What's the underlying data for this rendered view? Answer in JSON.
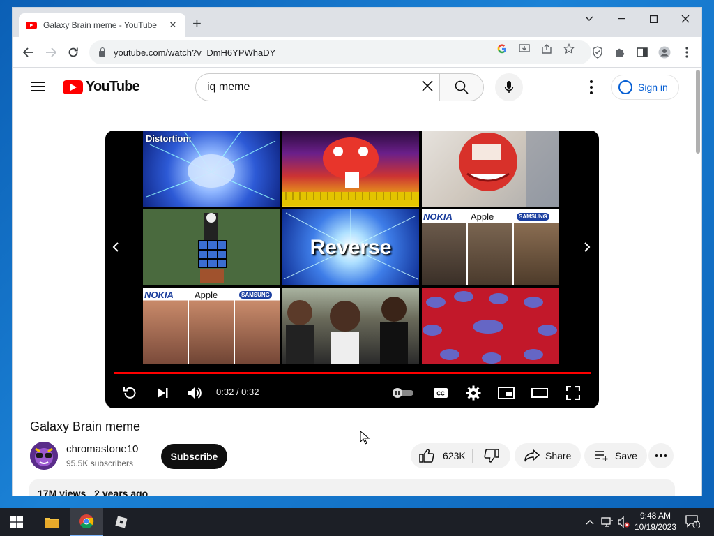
{
  "browser": {
    "tab_title": "Galaxy Brain meme - YouTube",
    "url": "youtube.com/watch?v=DmH6YPWhaDY",
    "icons": [
      "back-icon",
      "forward-icon",
      "reload-icon",
      "google-icon",
      "install-icon",
      "share-icon",
      "bookmark-star-icon",
      "shield-extension-icon",
      "puzzle-extensions-icon",
      "sidebar-icon",
      "profile-icon",
      "menu-icon"
    ]
  },
  "youtube": {
    "logo_text": "YouTube",
    "search_value": "iq meme",
    "signin_label": "Sign in"
  },
  "player": {
    "time_current": "0:32",
    "time_total": "0:32",
    "time_display": "0:32 / 0:32",
    "progress": 1.0,
    "overlay_texts": {
      "distortion": "Distortion:",
      "reverse": "Reverse",
      "nokia": "NOKIA",
      "apple": "Apple",
      "samsung": "SAMSUNG"
    }
  },
  "video": {
    "title": "Galaxy Brain meme",
    "channel": "chromastone10",
    "subscribers": "95.5K subscribers",
    "subscribe_label": "Subscribe",
    "likes": "623K",
    "share_label": "Share",
    "save_label": "Save",
    "views": "17M views",
    "age": "2 years ago"
  },
  "taskbar": {
    "time": "9:48 AM",
    "date": "10/19/2023",
    "notification_count": "1"
  },
  "colors": {
    "youtube_red": "#ff0000",
    "link_blue": "#065fd4",
    "desktop_blue": "#0f6fc6"
  }
}
